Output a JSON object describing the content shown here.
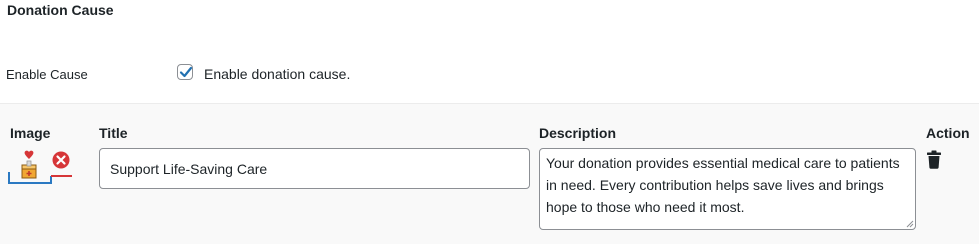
{
  "section": {
    "title": "Donation Cause"
  },
  "enable_cause": {
    "label": "Enable Cause",
    "checkbox_checked": true,
    "checkbox_text": "Enable donation cause."
  },
  "causes_table": {
    "headers": {
      "image": "Image",
      "title": "Title",
      "description": "Description",
      "action": "Action"
    },
    "rows": [
      {
        "image_icon": "charity-box-heart-icon",
        "title": "Support Life-Saving Care",
        "description": "Your donation provides essential medical care to patients in need. Every contribution helps save lives and brings hope to those who need it most.",
        "remove_image_icon": "remove-circle-icon",
        "action_icon": "trash-icon"
      }
    ]
  },
  "colors": {
    "checkbox_accent": "#2271b1",
    "remove_red": "#d63638",
    "panel_bg": "#f9f9f9",
    "text": "#1d2327"
  }
}
